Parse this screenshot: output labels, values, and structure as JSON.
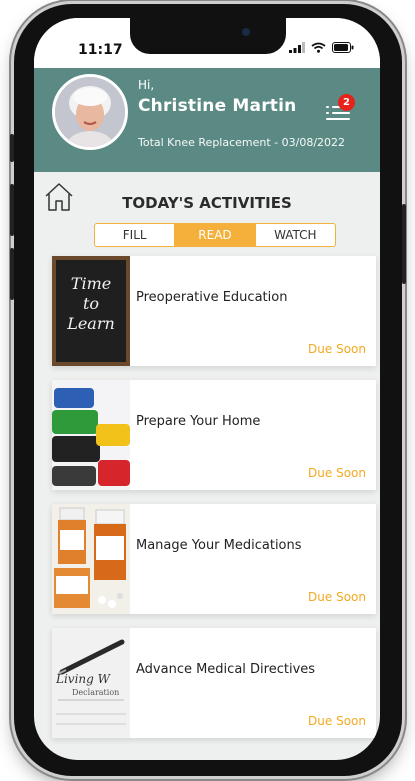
{
  "status": {
    "time": "11:17"
  },
  "header": {
    "greeting": "Hi,",
    "user_name": "Christine Martin",
    "procedure": "Total Knee Replacement - 03/08/2022",
    "notification_count": "2",
    "colors": {
      "header_bg": "#5a8a83",
      "badge": "#e5231b"
    }
  },
  "activities": {
    "title": "TODAY'S ACTIVITIES",
    "tabs": [
      {
        "label": "FILL",
        "active": false
      },
      {
        "label": "READ",
        "active": true
      },
      {
        "label": "WATCH",
        "active": false
      }
    ],
    "items": [
      {
        "title": "Preoperative Education",
        "status": "Due Soon",
        "thumb_text": [
          "Time",
          "to",
          "Learn"
        ],
        "icon": "chalkboard-thumbnail"
      },
      {
        "title": "Prepare Your Home",
        "status": "Due Soon",
        "icon": "storage-containers-thumbnail"
      },
      {
        "title": "Manage Your Medications",
        "status": "Due Soon",
        "icon": "pill-bottles-thumbnail"
      },
      {
        "title": "Advance Medical Directives",
        "status": "Due Soon",
        "thumb_text": [
          "Living W",
          "Declaration"
        ],
        "icon": "living-will-document-thumbnail"
      }
    ],
    "colors": {
      "accent": "#f4b03a",
      "due": "#f3a91f"
    }
  }
}
